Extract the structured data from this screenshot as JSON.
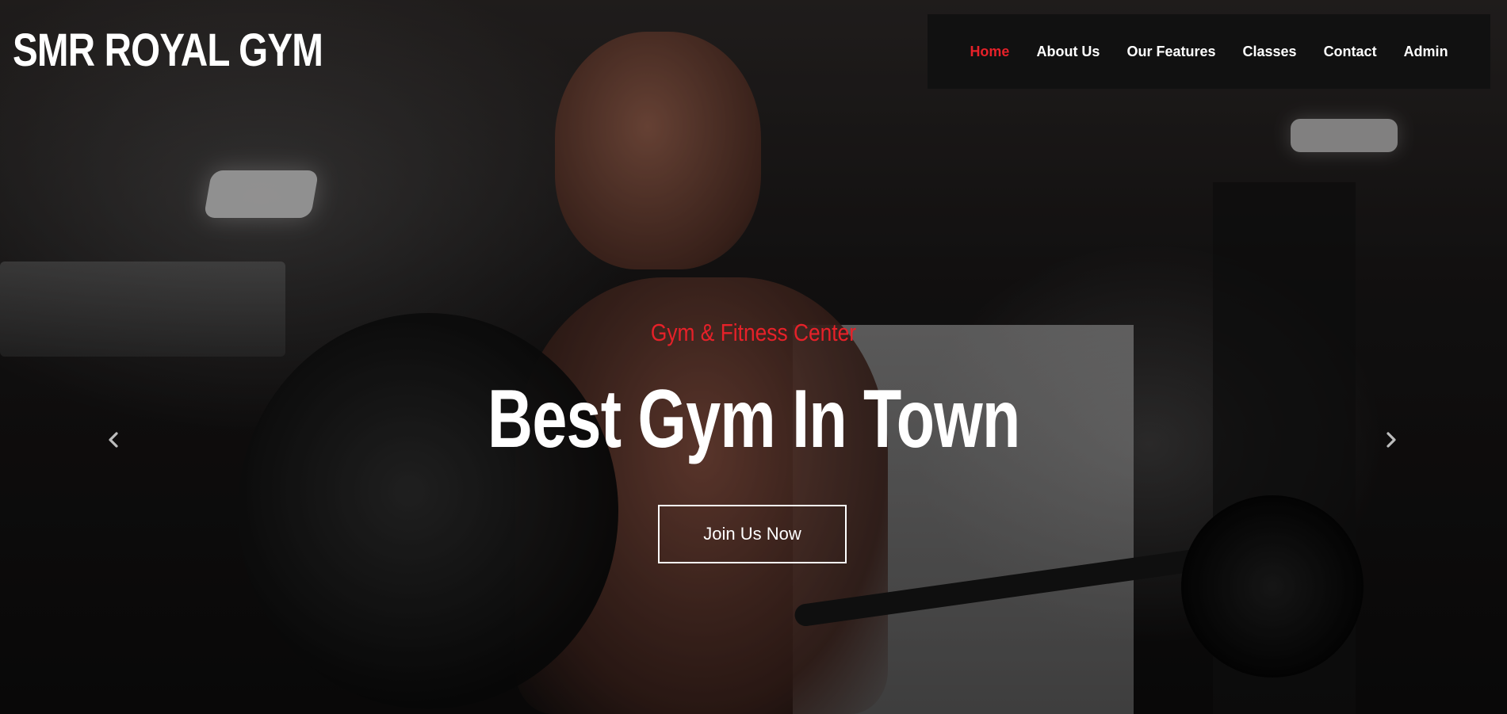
{
  "site": {
    "logo_text": "SMR ROYAL GYM"
  },
  "nav": {
    "items": [
      {
        "label": "Home",
        "active": true
      },
      {
        "label": "About Us",
        "active": false
      },
      {
        "label": "Our Features",
        "active": false
      },
      {
        "label": "Classes",
        "active": false
      },
      {
        "label": "Contact",
        "active": false
      },
      {
        "label": "Admin",
        "active": false
      }
    ]
  },
  "hero": {
    "subtitle": "Gym & Fitness Center",
    "headline": "Best Gym In Town",
    "cta_label": "Join Us Now",
    "prev_icon": "chevron-left-icon",
    "next_icon": "chevron-right-icon"
  },
  "colors": {
    "accent": "#e62129",
    "nav_bg": "#111111",
    "text": "#ffffff"
  }
}
